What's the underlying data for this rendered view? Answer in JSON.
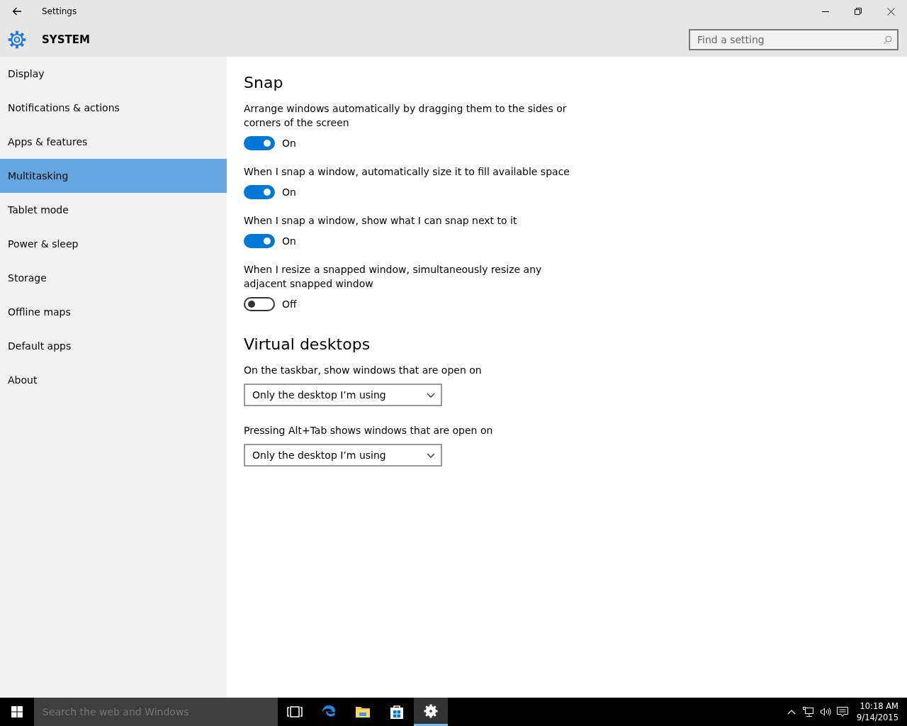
{
  "window": {
    "title": "Settings"
  },
  "header": {
    "title": "SYSTEM",
    "search": {
      "placeholder": "Find a setting"
    }
  },
  "sidebar": {
    "items": [
      {
        "label": "Display",
        "selected": false
      },
      {
        "label": "Notifications & actions",
        "selected": false
      },
      {
        "label": "Apps & features",
        "selected": false
      },
      {
        "label": "Multitasking",
        "selected": true
      },
      {
        "label": "Tablet mode",
        "selected": false
      },
      {
        "label": "Power & sleep",
        "selected": false
      },
      {
        "label": "Storage",
        "selected": false
      },
      {
        "label": "Offline maps",
        "selected": false
      },
      {
        "label": "Default apps",
        "selected": false
      },
      {
        "label": "About",
        "selected": false
      }
    ]
  },
  "sections": [
    {
      "title": "Snap",
      "settings": [
        {
          "kind": "toggle",
          "label": "Arrange windows automatically by dragging them to the sides or corners of the screen",
          "on": true,
          "state_text": "On"
        },
        {
          "kind": "toggle",
          "label": "When I snap a window, automatically size it to fill available space",
          "on": true,
          "state_text": "On"
        },
        {
          "kind": "toggle",
          "label": "When I snap a window, show what I can snap next to it",
          "on": true,
          "state_text": "On"
        },
        {
          "kind": "toggle",
          "label": "When I resize a snapped window, simultaneously resize any adjacent snapped window",
          "on": false,
          "state_text": "Off"
        }
      ]
    },
    {
      "title": "Virtual desktops",
      "settings": [
        {
          "kind": "dropdown",
          "label": "On the taskbar, show windows that are open on",
          "value": "Only the desktop I’m using"
        },
        {
          "kind": "dropdown",
          "label": "Pressing Alt+Tab shows windows that are open on",
          "value": "Only the desktop I’m using"
        }
      ]
    }
  ],
  "taskbar": {
    "search": {
      "placeholder": "Search the web and Windows"
    },
    "apps": [
      {
        "kind": "taskview",
        "selected": false
      },
      {
        "kind": "edge",
        "selected": false
      },
      {
        "kind": "explorer",
        "selected": false
      },
      {
        "kind": "store",
        "selected": false
      },
      {
        "kind": "settings",
        "selected": true
      }
    ],
    "time": "10:18 AM",
    "date": "9/14/2015"
  }
}
